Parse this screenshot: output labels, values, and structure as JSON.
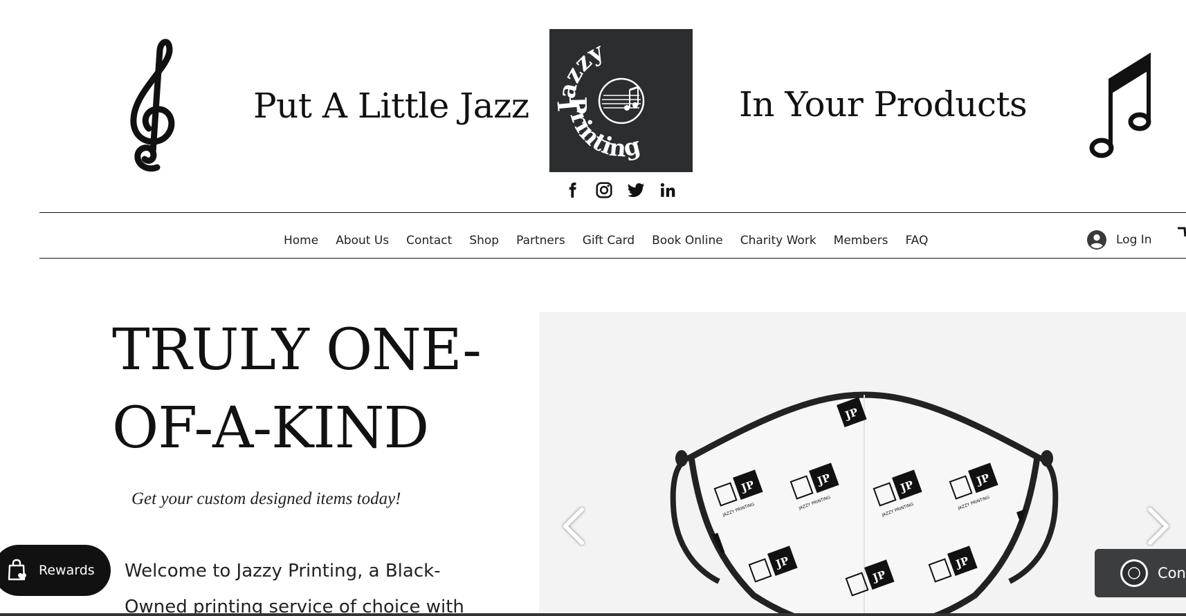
{
  "header": {
    "tagline_left": "Put A Little Jazz",
    "tagline_right": "In Your Products",
    "logo": {
      "text_top": "Jazzy",
      "text_bottom": "Printing",
      "background": "#2b2d2f"
    }
  },
  "social": [
    {
      "name": "facebook-icon"
    },
    {
      "name": "instagram-icon"
    },
    {
      "name": "twitter-icon"
    },
    {
      "name": "linkedin-icon"
    }
  ],
  "nav": {
    "items": [
      {
        "label": "Home"
      },
      {
        "label": "About Us"
      },
      {
        "label": "Contact"
      },
      {
        "label": "Shop"
      },
      {
        "label": "Partners"
      },
      {
        "label": "Gift Card"
      },
      {
        "label": "Book Online"
      },
      {
        "label": "Charity Work"
      },
      {
        "label": "Members"
      },
      {
        "label": "FAQ"
      }
    ],
    "login_label": "Log In"
  },
  "hero": {
    "title_line1": "TRULY ONE-",
    "title_line2": "OF-A-KIND",
    "subtitle": "Get your custom designed items today!",
    "welcome_line1": "Welcome to Jazzy Printing, a Black-",
    "welcome_line2": "Owned printing service of choice with"
  },
  "slider": {
    "image_label": "JP",
    "image_caption": "JAZZY PRINTING"
  },
  "rewards": {
    "label": "Rewards"
  },
  "contact_widget": {
    "label": "Con"
  }
}
